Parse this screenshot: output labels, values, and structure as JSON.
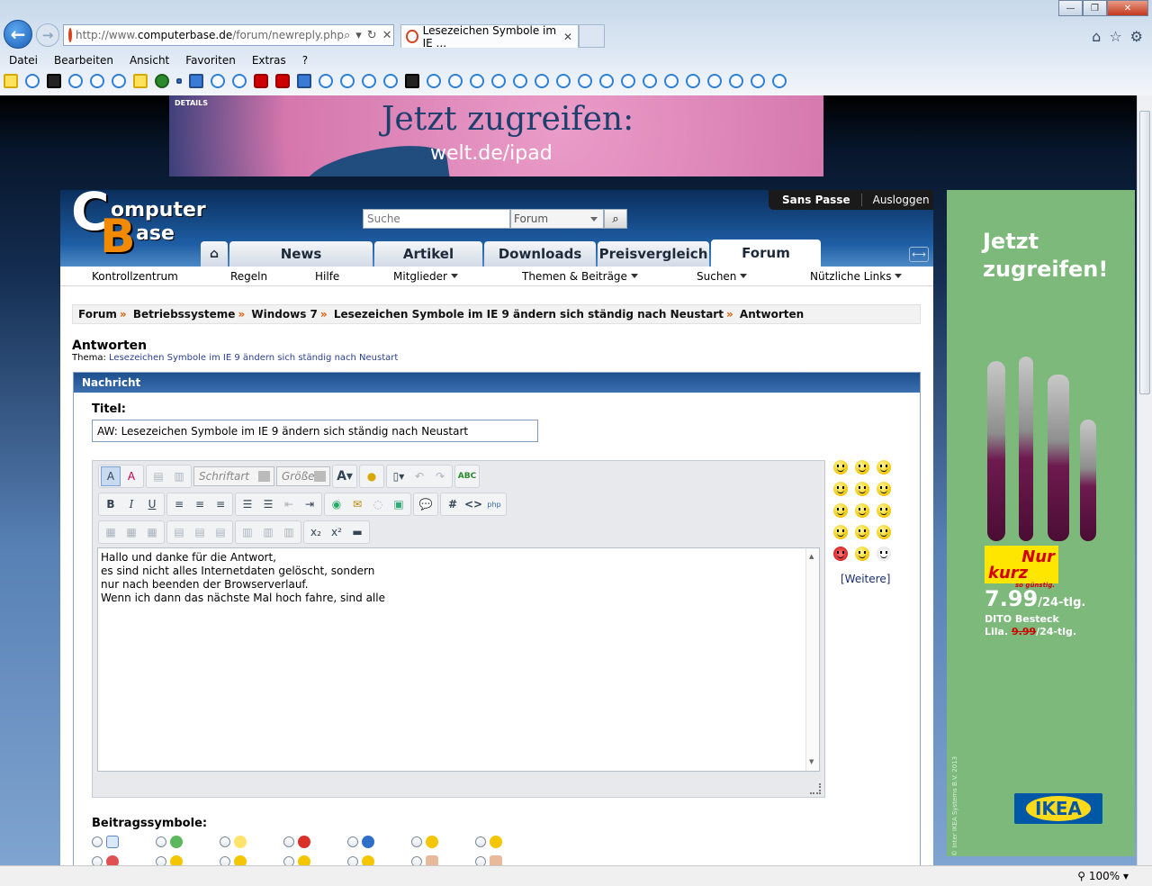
{
  "browser": {
    "url_prefix": "http://www.",
    "url_domain": "computerbase.de",
    "url_path": "/forum/newreply.php",
    "tab_title": "Lesezeichen Symbole im IE ...",
    "menu": [
      "Datei",
      "Bearbeiten",
      "Ansicht",
      "Favoriten",
      "Extras",
      "?"
    ],
    "zoom": "100%"
  },
  "ads": {
    "top_details": "DETAILS",
    "top_headline": "Jetzt zugreifen:",
    "top_url": "welt.de/ipad",
    "side_headline_1": "Jetzt",
    "side_headline_2": "zugreifen!",
    "side_badge_1": "Nur",
    "side_badge_2": "kurz",
    "side_badge_3": "so günstig.",
    "side_price": "7.99",
    "side_price_unit": "/24-tlg.",
    "side_product": "DITO Besteck",
    "side_variant": "Lila.",
    "side_old_price": "9.99",
    "side_old_unit": "/24-tlg.",
    "side_brand": "IKEA",
    "side_copyright": "© Inter IKEA Systems B.V. 2013"
  },
  "site": {
    "logo_c": "C",
    "logo_word1": "omputer",
    "logo_b": "B",
    "logo_word2": "ase",
    "search_placeholder": "Suche",
    "search_scope": "Forum",
    "user_name": "Sans Passe",
    "logout": "Ausloggen",
    "tabs": [
      "News",
      "Artikel",
      "Downloads",
      "Preisvergleich",
      "Forum"
    ],
    "subnav": [
      "Kontrollzentrum",
      "Regeln",
      "Hilfe",
      "Mitglieder",
      "Themen & Beiträge",
      "Suchen",
      "Nützliche Links"
    ]
  },
  "breadcrumb": [
    "Forum",
    "Betriebssysteme",
    "Windows 7",
    "Lesezeichen Symbole im IE 9 ändern sich ständig nach Neustart",
    "Antworten"
  ],
  "page": {
    "title": "Antworten",
    "thema_label": "Thema:",
    "thema_link": "Lesezeichen Symbole im IE 9 ändern sich ständig nach Neustart",
    "box_header": "Nachricht",
    "title_label": "Titel:",
    "title_value": "AW: Lesezeichen Symbole im IE 9 ändern sich ständig nach Neustart",
    "font_dropdown": "Schriftart",
    "size_dropdown": "Größe",
    "message_lines": [
      "Hallo und danke für die Antwort,",
      "es sind nicht alles Internetdaten gelöscht, sondern",
      "nur nach beenden der Browserverlauf.",
      "Wenn ich dann das nächste Mal hoch fahre, sind alle"
    ],
    "more_smilies": "[Weitere]",
    "post_icons_label": "Beitragssymbole:"
  },
  "colors": {
    "breadcrumb_sep": "#e05a00",
    "link": "#2a3f8f",
    "ad_green": "#7cb97b"
  }
}
